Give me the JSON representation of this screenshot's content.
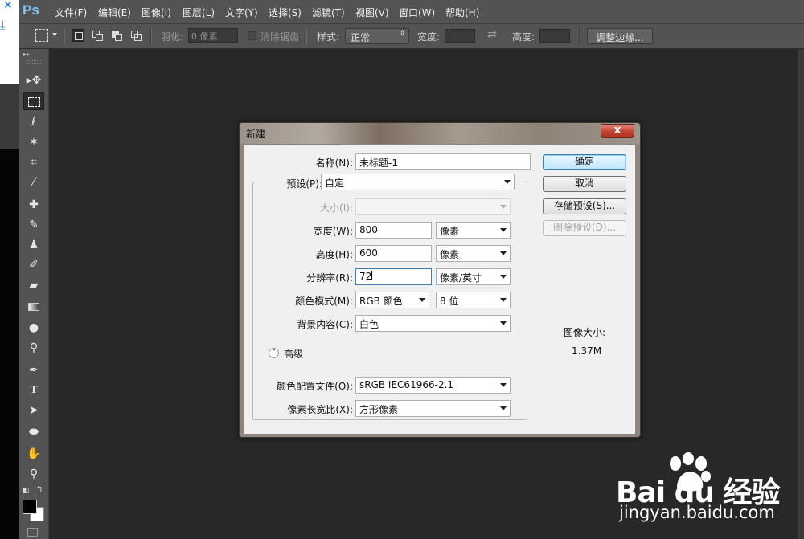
{
  "app": {
    "logo": "Ps",
    "menu": [
      "文件(F)",
      "编辑(E)",
      "图像(I)",
      "图层(L)",
      "文字(Y)",
      "选择(S)",
      "滤镜(T)",
      "视图(V)",
      "窗口(W)",
      "帮助(H)"
    ]
  },
  "options_bar": {
    "feather_label": "羽化:",
    "feather_value": "0 像素",
    "antialias_label": "消除锯齿",
    "style_label": "样式:",
    "style_value": "正常",
    "width_label": "宽度:",
    "height_label": "高度:",
    "refine_edge_button": "调整边缘..."
  },
  "dialog": {
    "title": "新建",
    "close_glyph": "x",
    "name_label": "名称(N):",
    "name_value": "未标题-1",
    "preset_label": "预设(P):",
    "preset_value": "自定",
    "size_label": "大小(I):",
    "width_label": "宽度(W):",
    "width_value": "800",
    "width_unit": "像素",
    "height_label": "高度(H):",
    "height_value": "600",
    "height_unit": "像素",
    "resolution_label": "分辨率(R):",
    "resolution_value": "72",
    "resolution_unit": "像素/英寸",
    "color_mode_label": "颜色模式(M):",
    "color_mode_value": "RGB 颜色",
    "bit_depth_value": "8 位",
    "background_label": "背景内容(C):",
    "background_value": "白色",
    "advanced_label": "高级",
    "color_profile_label": "颜色配置文件(O):",
    "color_profile_value": "sRGB IEC61966-2.1",
    "pixel_aspect_label": "像素长宽比(X):",
    "pixel_aspect_value": "方形像素",
    "ok_button": "确定",
    "cancel_button": "取消",
    "save_preset_button": "存储预设(S)...",
    "delete_preset_button": "删除预设(D)...",
    "image_size_label": "图像大小:",
    "image_size_value": "1.37M"
  },
  "watermark": {
    "brand": "Bai du 经验",
    "site": "jingyan.baidu.com"
  },
  "colors": {
    "foreground": "#000000",
    "background": "#ffffff",
    "app_bg": "#282828",
    "panel": "#535353"
  }
}
